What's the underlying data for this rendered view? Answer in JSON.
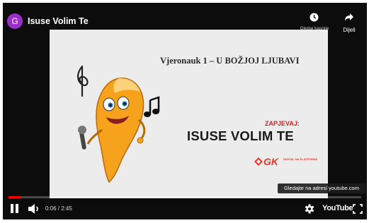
{
  "header": {
    "avatar_letter": "G",
    "title": "Isuse Volim Te",
    "watch_later_label": "Gledaj kasnije",
    "share_label": "Dijeli"
  },
  "slide": {
    "subtitle": "Vjeronauk 1 – U BOŽJOJ LJUBAVI",
    "kicker": "ZAPJEVAJ:",
    "title": "ISUSE VOLIM TE",
    "logo_text": "GK",
    "logo_subtext": "DIGITAL NA PLATFORMA"
  },
  "tooltip": "Gledajte na adresi youtube.com",
  "controls": {
    "time": "0:06 / 2:45",
    "progress_fraction": 0.036,
    "brand_label": "YouTube"
  },
  "colors": {
    "avatar": "#9c2fc9",
    "progress": "#ff0000",
    "accent_red": "#d42323"
  },
  "icons": [
    "play-pause-icon",
    "volume-icon",
    "settings-icon",
    "fullscreen-icon",
    "clock-icon",
    "share-icon"
  ]
}
